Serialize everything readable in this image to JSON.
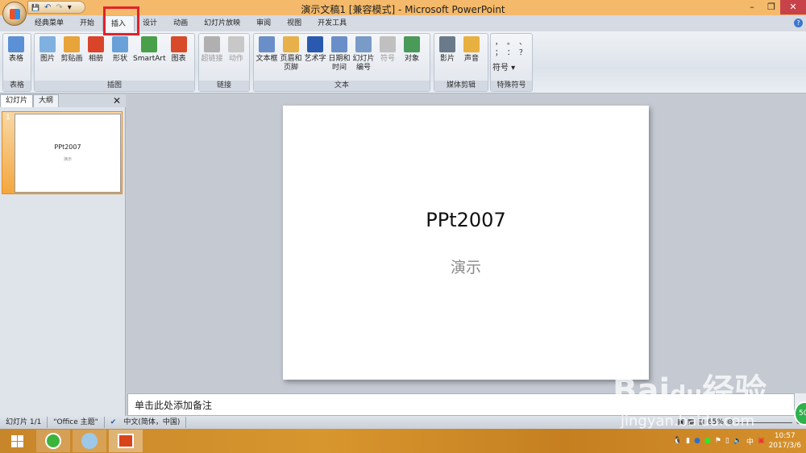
{
  "window": {
    "title": "演示文稿1 [兼容模式] - Microsoft PowerPoint",
    "minimize": "–",
    "restore": "❐",
    "close": "✕",
    "accent": "#f4b96a"
  },
  "qat": {
    "save": "💾",
    "undo": "↶",
    "redo": "↷",
    "customize": "▾"
  },
  "tabs": [
    "经典菜单",
    "开始",
    "插入",
    "设计",
    "动画",
    "幻灯片放映",
    "审阅",
    "视图",
    "开发工具"
  ],
  "active_tab": "插入",
  "help": "?",
  "ribbon": {
    "groups": [
      {
        "label": "表格",
        "buttons": [
          "表格"
        ]
      },
      {
        "label": "插图",
        "buttons": [
          "图片",
          "剪贴画",
          "相册",
          "形状",
          "SmartArt",
          "图表"
        ]
      },
      {
        "label": "链接",
        "buttons": [
          "超链接",
          "动作"
        ]
      },
      {
        "label": "文本",
        "buttons": [
          "文本框",
          "页眉和\n页脚",
          "艺术字",
          "日期和\n时间",
          "幻灯片\n编号",
          "符号",
          "对象"
        ]
      },
      {
        "label": "媒体剪辑",
        "buttons": [
          "影片",
          "声音"
        ]
      },
      {
        "label": "特殊符号",
        "symbols": [
          "，",
          "。",
          "、",
          "；",
          "：",
          "？"
        ],
        "button": "符号 ▾"
      }
    ]
  },
  "left_pane": {
    "tabs": [
      "幻灯片",
      "大纲"
    ],
    "close": "✕",
    "slide_number": "1",
    "thumb_title": "PPt2007",
    "thumb_subtitle": "演示"
  },
  "slide": {
    "title": "PPt2007",
    "subtitle": "演示"
  },
  "notes": {
    "placeholder": "单击此处添加备注"
  },
  "status": {
    "slide": "幻灯片 1/1",
    "theme": "\"Office 主题\"",
    "lang": "中文(简体，中国)",
    "zoom": "65%"
  },
  "taskbar": {
    "tray_lang": "中",
    "time": "10:57",
    "date": "2017/3/6"
  },
  "watermark": {
    "logo": "Baidu经验",
    "url": "jingyan.baidu.com",
    "badge": "50"
  }
}
